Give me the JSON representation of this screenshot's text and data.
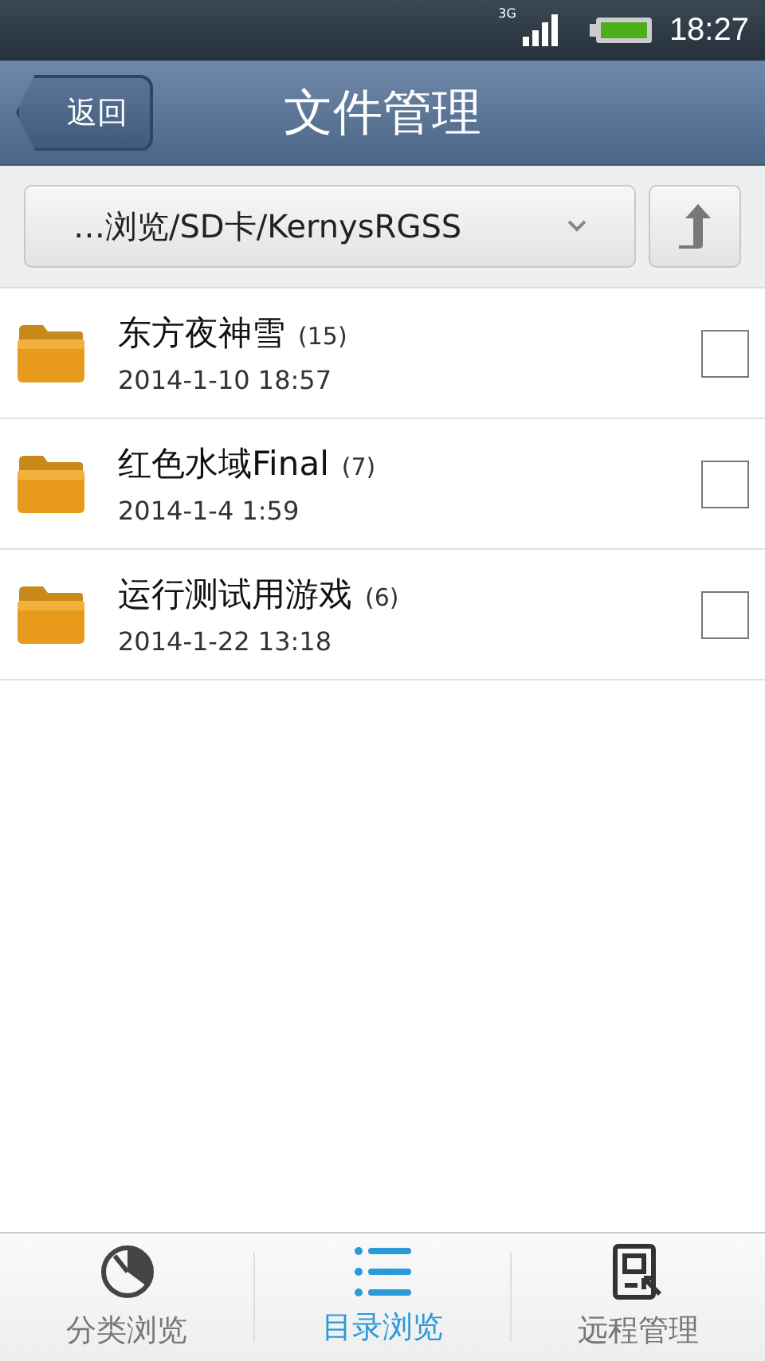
{
  "status_bar": {
    "network": "3G",
    "time": "18:27"
  },
  "header": {
    "back": "返回",
    "title": "文件管理"
  },
  "path": {
    "value": "…浏览/SD卡/KernysRGSS"
  },
  "items": [
    {
      "name": "东方夜神雪",
      "count": "(15)",
      "date": "2014-1-10 18:57",
      "checked": false
    },
    {
      "name": "红色水域Final",
      "count": "(7)",
      "date": "2014-1-4 1:59",
      "checked": false
    },
    {
      "name": "运行测试用游戏",
      "count": "(6)",
      "date": "2014-1-22 13:18",
      "checked": false
    }
  ],
  "tabs": [
    {
      "label": "分类浏览",
      "kind": "pie",
      "selected": false
    },
    {
      "label": "目录浏览",
      "kind": "list",
      "selected": true
    },
    {
      "label": "远程管理",
      "kind": "remote",
      "selected": false
    }
  ]
}
